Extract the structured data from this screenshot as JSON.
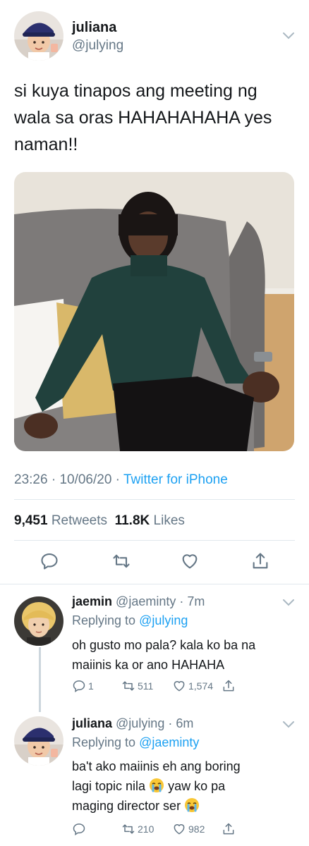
{
  "tweet": {
    "author_name": "juliana",
    "author_handle": "@julying",
    "text": "si kuya tinapos ang meeting ng wala sa oras HAHAHAHAHA yes naman!!",
    "time": "23:26",
    "date": "10/06/20",
    "source": "Twitter for iPhone",
    "retweets_count": "9,451",
    "retweets_label": "Retweets",
    "likes_count": "11.8K",
    "likes_label": "Likes"
  },
  "replies": [
    {
      "name": "jaemin",
      "handle": "@jaeminty",
      "age": "7m",
      "replying_label": "Replying to",
      "replying_to": "@julying",
      "text": "oh gusto mo pala? kala ko ba na maiinis ka or ano HAHAHA",
      "reply_count": "1",
      "retweet_count": "511",
      "like_count": "1,574"
    },
    {
      "name": "juliana",
      "handle": "@julying",
      "age": "6m",
      "replying_label": "Replying to",
      "replying_to": "@jaeminty",
      "text_line1": "ba't ako maiinis eh ang boring",
      "text_line2": "lagi topic nila",
      "text_line2b": "yaw ko pa",
      "text_line3": "maging director ser",
      "reply_count": "",
      "retweet_count": "210",
      "like_count": "982"
    }
  ],
  "icons": {
    "reply": "reply-icon",
    "retweet": "retweet-icon",
    "like": "heart-icon",
    "share": "share-icon",
    "more": "chevron-down-icon",
    "emoji": "loudly-crying-face-emoji"
  },
  "colors": {
    "link": "#1da1f2",
    "secondary": "#657786",
    "divider": "#e1e8ed"
  }
}
